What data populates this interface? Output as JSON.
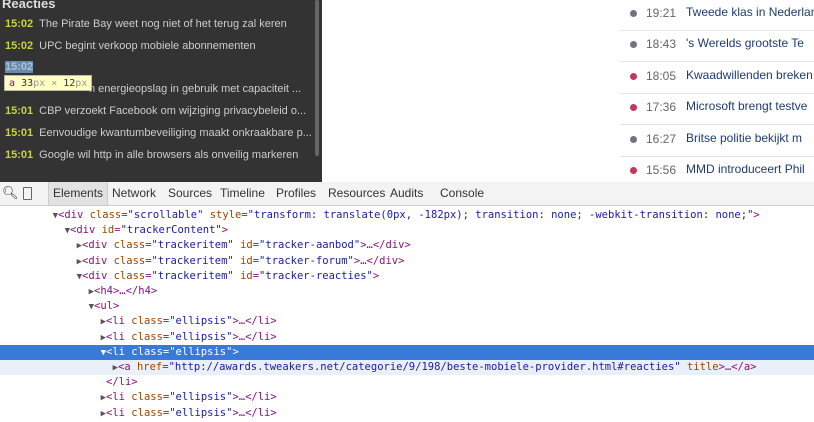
{
  "tracker": {
    "heading": "Reacties",
    "items": [
      {
        "time": "15:02",
        "title": "The Pirate Bay weet nog niet of het terug zal keren"
      },
      {
        "time": "15:02",
        "title": "UPC begint verkoop mobiele abonnementen"
      },
      {
        "time": "15:02",
        "title": ""
      },
      {
        "time": "",
        "title": "n energieopslag in gebruik met capaciteit ..."
      },
      {
        "time": "15:01",
        "title": "CBP verzoekt Facebook om wijziging privacybeleid o..."
      },
      {
        "time": "15:01",
        "title": "Eenvoudige kwantumbeveiliging maakt onkraakbare p..."
      },
      {
        "time": "15:01",
        "title": "Google wil http in alle browsers als onveilig markeren"
      }
    ]
  },
  "tooltip": {
    "tag": "a",
    "width": "33",
    "height": "12",
    "unit": "px",
    "times": "×"
  },
  "news": [
    {
      "time": "19:21",
      "title": "Tweede klas in Nederland",
      "dot": "#7a6e80"
    },
    {
      "time": "18:43",
      "title": "'s Werelds grootste Te",
      "dot": "#7a6e80"
    },
    {
      "time": "18:05",
      "title": "Kwaadwillenden breken",
      "dot": "#c0395a"
    },
    {
      "time": "17:36",
      "title": "Microsoft brengt testve",
      "dot": "#c0395a"
    },
    {
      "time": "16:27",
      "title": "Britse politie bekijkt m",
      "dot": "#7a6e80"
    },
    {
      "time": "15:56",
      "title": "MMD introduceert Phil",
      "dot": "#c0395a"
    }
  ],
  "devtools": {
    "tabs": [
      "Elements",
      "Network",
      "Sources",
      "Timeline",
      "Profiles",
      "Resources",
      "Audits",
      "Console"
    ],
    "dom": [
      {
        "indent": 0,
        "tri": "▼",
        "parts": [
          [
            "t",
            "<div "
          ],
          [
            "a",
            "class"
          ],
          [
            "t",
            "="
          ],
          [
            "v",
            "\"scrollable\""
          ],
          [
            "t",
            " "
          ],
          [
            "a",
            "style"
          ],
          [
            "t",
            "="
          ],
          [
            "v",
            "\"transform: translate(0px, -182px); transition: none; -webkit-transition: none;\""
          ],
          [
            "t",
            ">"
          ]
        ]
      },
      {
        "indent": 1,
        "tri": "▼",
        "parts": [
          [
            "t",
            "<div "
          ],
          [
            "a",
            "id"
          ],
          [
            "t",
            "="
          ],
          [
            "v",
            "\"trackerContent\""
          ],
          [
            "t",
            ">"
          ]
        ]
      },
      {
        "indent": 2,
        "tri": "▶",
        "parts": [
          [
            "t",
            "<div "
          ],
          [
            "a",
            "class"
          ],
          [
            "t",
            "="
          ],
          [
            "v",
            "\"trackeritem\""
          ],
          [
            "t",
            " "
          ],
          [
            "a",
            "id"
          ],
          [
            "t",
            "="
          ],
          [
            "v",
            "\"tracker-aanbod\""
          ],
          [
            "t",
            ">…</div>"
          ]
        ]
      },
      {
        "indent": 2,
        "tri": "▶",
        "parts": [
          [
            "t",
            "<div "
          ],
          [
            "a",
            "class"
          ],
          [
            "t",
            "="
          ],
          [
            "v",
            "\"trackeritem\""
          ],
          [
            "t",
            " "
          ],
          [
            "a",
            "id"
          ],
          [
            "t",
            "="
          ],
          [
            "v",
            "\"tracker-forum\""
          ],
          [
            "t",
            ">…</div>"
          ]
        ]
      },
      {
        "indent": 2,
        "tri": "▼",
        "parts": [
          [
            "t",
            "<div "
          ],
          [
            "a",
            "class"
          ],
          [
            "t",
            "="
          ],
          [
            "v",
            "\"trackeritem\""
          ],
          [
            "t",
            " "
          ],
          [
            "a",
            "id"
          ],
          [
            "t",
            "="
          ],
          [
            "v",
            "\"tracker-reacties\""
          ],
          [
            "t",
            ">"
          ]
        ]
      },
      {
        "indent": 3,
        "tri": "▶",
        "parts": [
          [
            "t",
            "<h4>…</h4>"
          ]
        ]
      },
      {
        "indent": 3,
        "tri": "▼",
        "parts": [
          [
            "t",
            "<ul>"
          ]
        ]
      },
      {
        "indent": 4,
        "tri": "▶",
        "parts": [
          [
            "t",
            "<li "
          ],
          [
            "a",
            "class"
          ],
          [
            "t",
            "="
          ],
          [
            "v",
            "\"ellipsis\""
          ],
          [
            "t",
            ">…</li>"
          ]
        ]
      },
      {
        "indent": 4,
        "tri": "▶",
        "parts": [
          [
            "t",
            "<li "
          ],
          [
            "a",
            "class"
          ],
          [
            "t",
            "="
          ],
          [
            "v",
            "\"ellipsis\""
          ],
          [
            "t",
            ">…</li>"
          ]
        ]
      },
      {
        "indent": 4,
        "tri": "▼",
        "sel": true,
        "parts": [
          [
            "t",
            "<li "
          ],
          [
            "a",
            "class"
          ],
          [
            "t",
            "="
          ],
          [
            "v",
            "\"ellipsis\""
          ],
          [
            "t",
            ">"
          ]
        ]
      },
      {
        "indent": 5,
        "tri": "▶",
        "hover": true,
        "parts": [
          [
            "t",
            "<a "
          ],
          [
            "a",
            "href"
          ],
          [
            "t",
            "="
          ],
          [
            "v",
            "\"http://awards.tweakers.net/categorie/9/198/beste-mobiele-provider.html#reacties\""
          ],
          [
            "t",
            " "
          ],
          [
            "a",
            "title"
          ],
          [
            "t",
            ">…</a>"
          ]
        ]
      },
      {
        "indent": 4,
        "tri": "",
        "parts": [
          [
            "t",
            "</li>"
          ]
        ]
      },
      {
        "indent": 4,
        "tri": "▶",
        "parts": [
          [
            "t",
            "<li "
          ],
          [
            "a",
            "class"
          ],
          [
            "t",
            "="
          ],
          [
            "v",
            "\"ellipsis\""
          ],
          [
            "t",
            ">…</li>"
          ]
        ]
      },
      {
        "indent": 4,
        "tri": "▶",
        "parts": [
          [
            "t",
            "<li "
          ],
          [
            "a",
            "class"
          ],
          [
            "t",
            "="
          ],
          [
            "v",
            "\"ellipsis\""
          ],
          [
            "t",
            ">…</li>"
          ]
        ]
      }
    ]
  }
}
